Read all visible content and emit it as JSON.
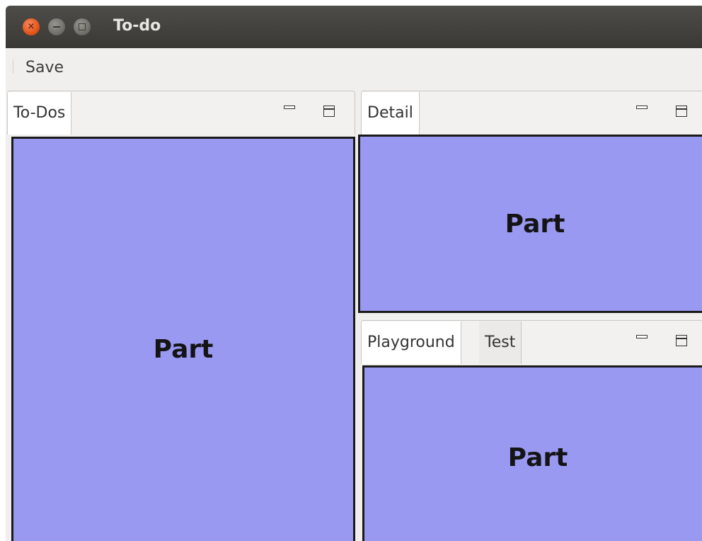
{
  "window": {
    "title": "To-do"
  },
  "toolbar": {
    "save_label": "Save"
  },
  "stacks": {
    "todos": {
      "tabs": [
        "To-Dos"
      ],
      "part_label": "Part"
    },
    "detail": {
      "tabs": [
        "Detail"
      ],
      "part_label": "Part"
    },
    "bottom": {
      "tabs": [
        "Playground",
        "Test"
      ],
      "part_label": "Part"
    }
  },
  "colors": {
    "part_fill": "#9a99f2",
    "titlebar": "#3c3b37",
    "close_button": "#e25519"
  }
}
